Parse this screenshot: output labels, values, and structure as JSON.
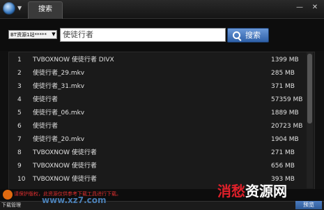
{
  "window": {
    "tab_label": "搜索",
    "min_glyph": "—",
    "close_glyph": "✕",
    "logo_arrow": "▼"
  },
  "search": {
    "source_select": "BT资源1站*****",
    "query": "使徒行者",
    "button_label": "搜索"
  },
  "results": [
    {
      "num": "1",
      "name": "TVBOXNOW 使徒行者 DIVX",
      "size": "1399 MB"
    },
    {
      "num": "2",
      "name": "使徒行者_29.mkv",
      "size": "285 MB"
    },
    {
      "num": "3",
      "name": "使徒行者_31.mkv",
      "size": "371 MB"
    },
    {
      "num": "4",
      "name": "使徒行者",
      "size": "57359 MB"
    },
    {
      "num": "5",
      "name": "使徒行者_06.mkv",
      "size": "1889 MB"
    },
    {
      "num": "6",
      "name": "使徒行者",
      "size": "20723 MB"
    },
    {
      "num": "7",
      "name": "使徒行者_20.mkv",
      "size": "1904 MB"
    },
    {
      "num": "8",
      "name": "TVBOXNOW 使徒行者",
      "size": "271 MB"
    },
    {
      "num": "9",
      "name": "TVBOXNOW 使徒行者",
      "size": "656 MB"
    },
    {
      "num": "10",
      "name": "TVBOXNOW 使徒行者",
      "size": "393 MB"
    }
  ],
  "status": {
    "message": "请保护版权，此资源仅供参考下载工具进行下载。"
  },
  "bottom": {
    "download_manager": "下载管理",
    "preview_label": "预览"
  },
  "watermark": {
    "url": "www.xz7.com",
    "site_prefix": "消愁",
    "site_suffix": "资源网"
  }
}
